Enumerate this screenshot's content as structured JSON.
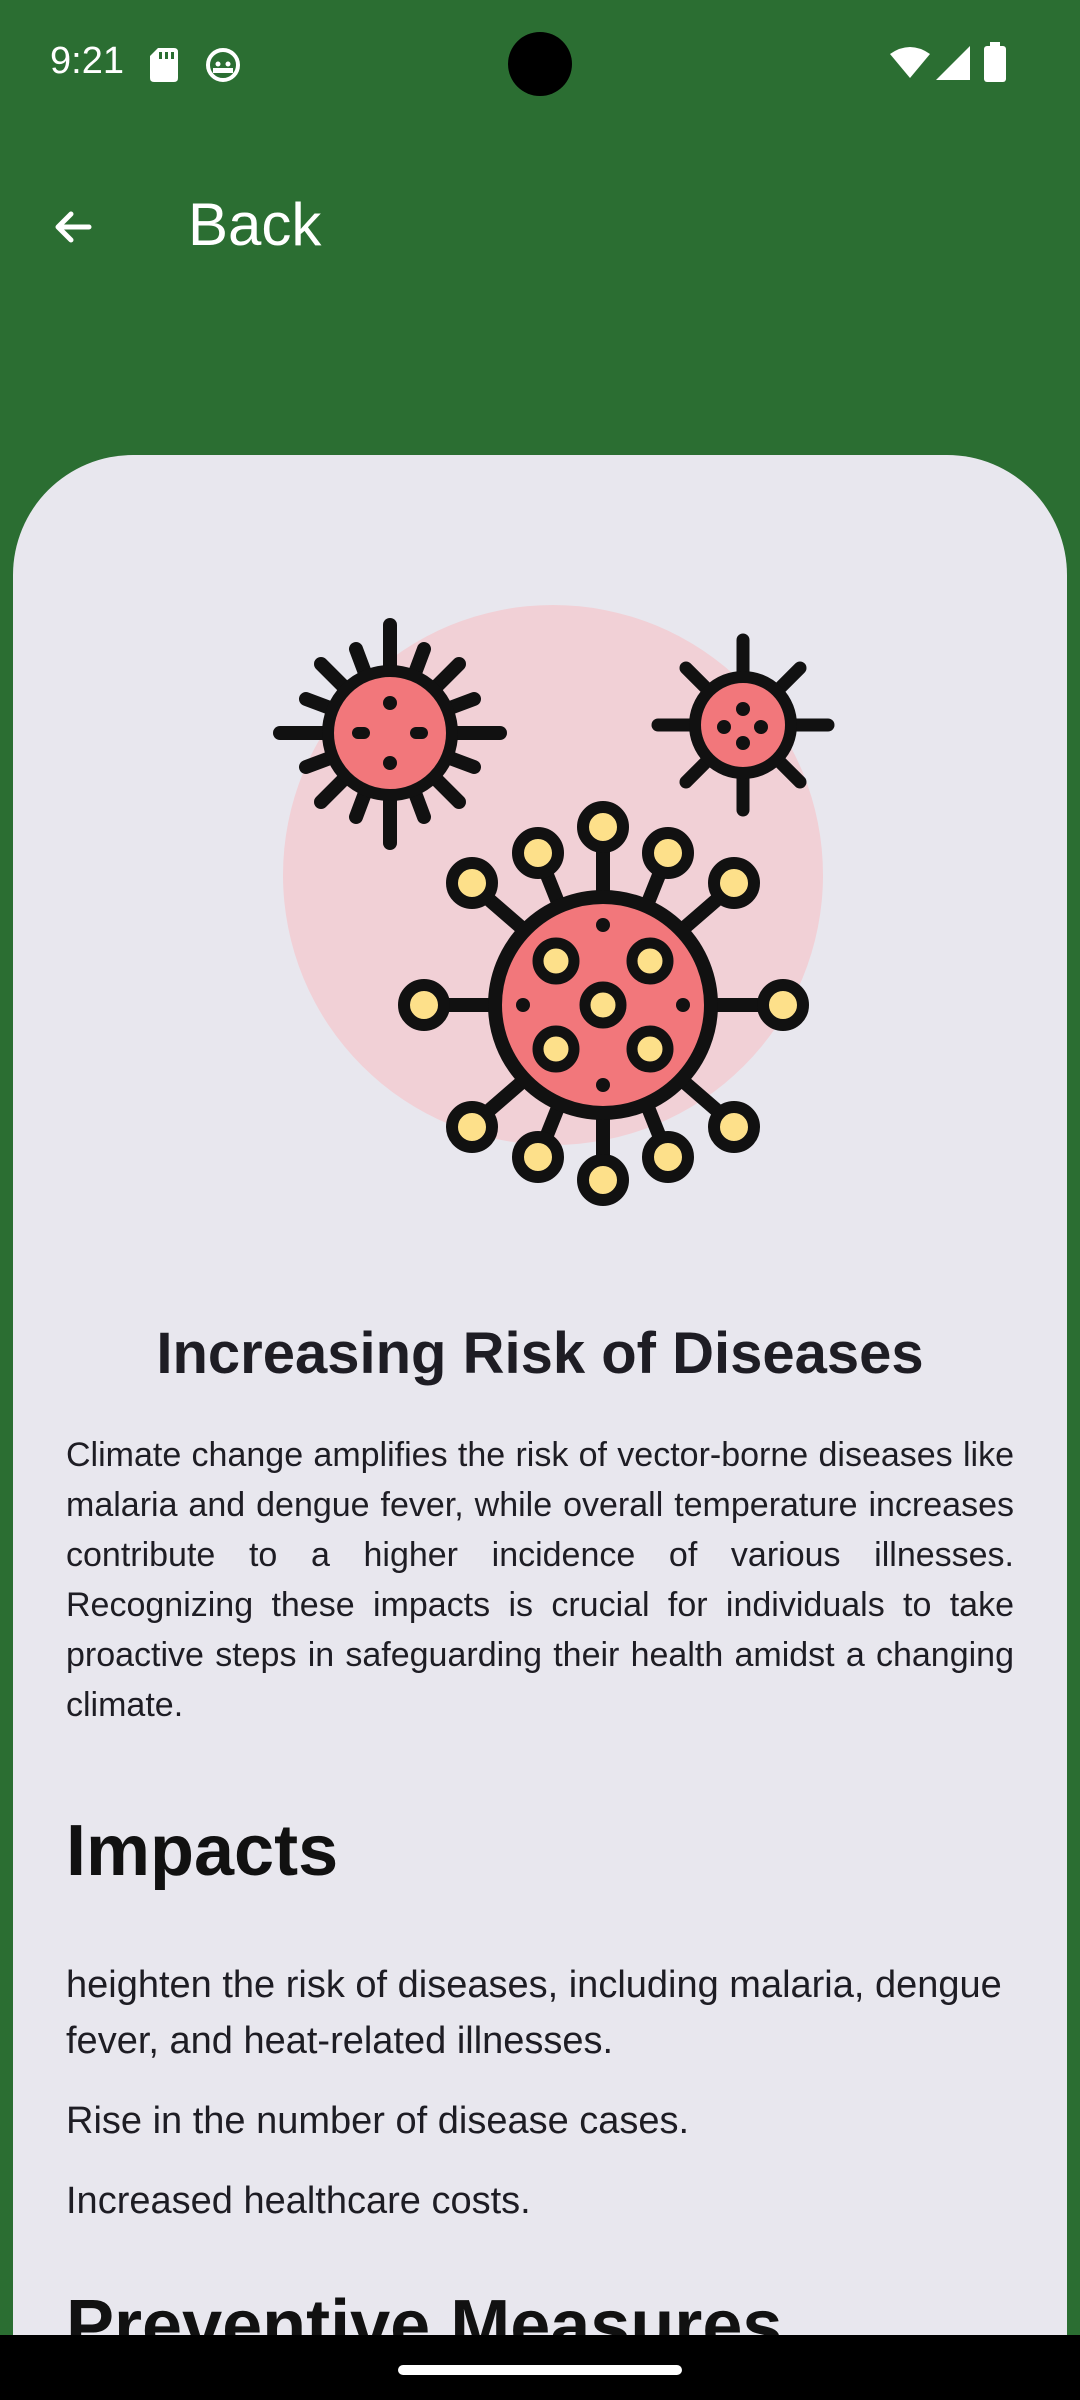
{
  "status_bar": {
    "time": "9:21",
    "icons": [
      "sd-card-icon",
      "android-icon",
      "wifi-icon",
      "signal-icon",
      "battery-icon"
    ]
  },
  "app_bar": {
    "back_icon": "arrow-left-icon",
    "back_label": "Back"
  },
  "article": {
    "illustration": "virus-icon",
    "title": "Increasing Risk of Diseases",
    "intro": "Climate change amplifies the risk of vector-borne diseases like malaria and dengue fever, while overall temperature increases contribute to a higher incidence of various illnesses. Recognizing these impacts is crucial for individuals to take proactive steps in safeguarding their health amidst a changing climate.",
    "impacts_heading": "Impacts",
    "impacts": [
      "heighten the risk of diseases, including malaria, dengue fever, and heat-related illnesses.",
      "Rise in the number of disease cases.",
      "Increased healthcare costs."
    ],
    "preventive_heading": "Preventive Measures"
  },
  "colors": {
    "app_bar_bg": "#2b6e32",
    "card_bg": "#e8e7ee",
    "virus_red": "#f2777b",
    "virus_pink_bg": "#f1d0d6",
    "virus_yellow": "#fde08a"
  }
}
